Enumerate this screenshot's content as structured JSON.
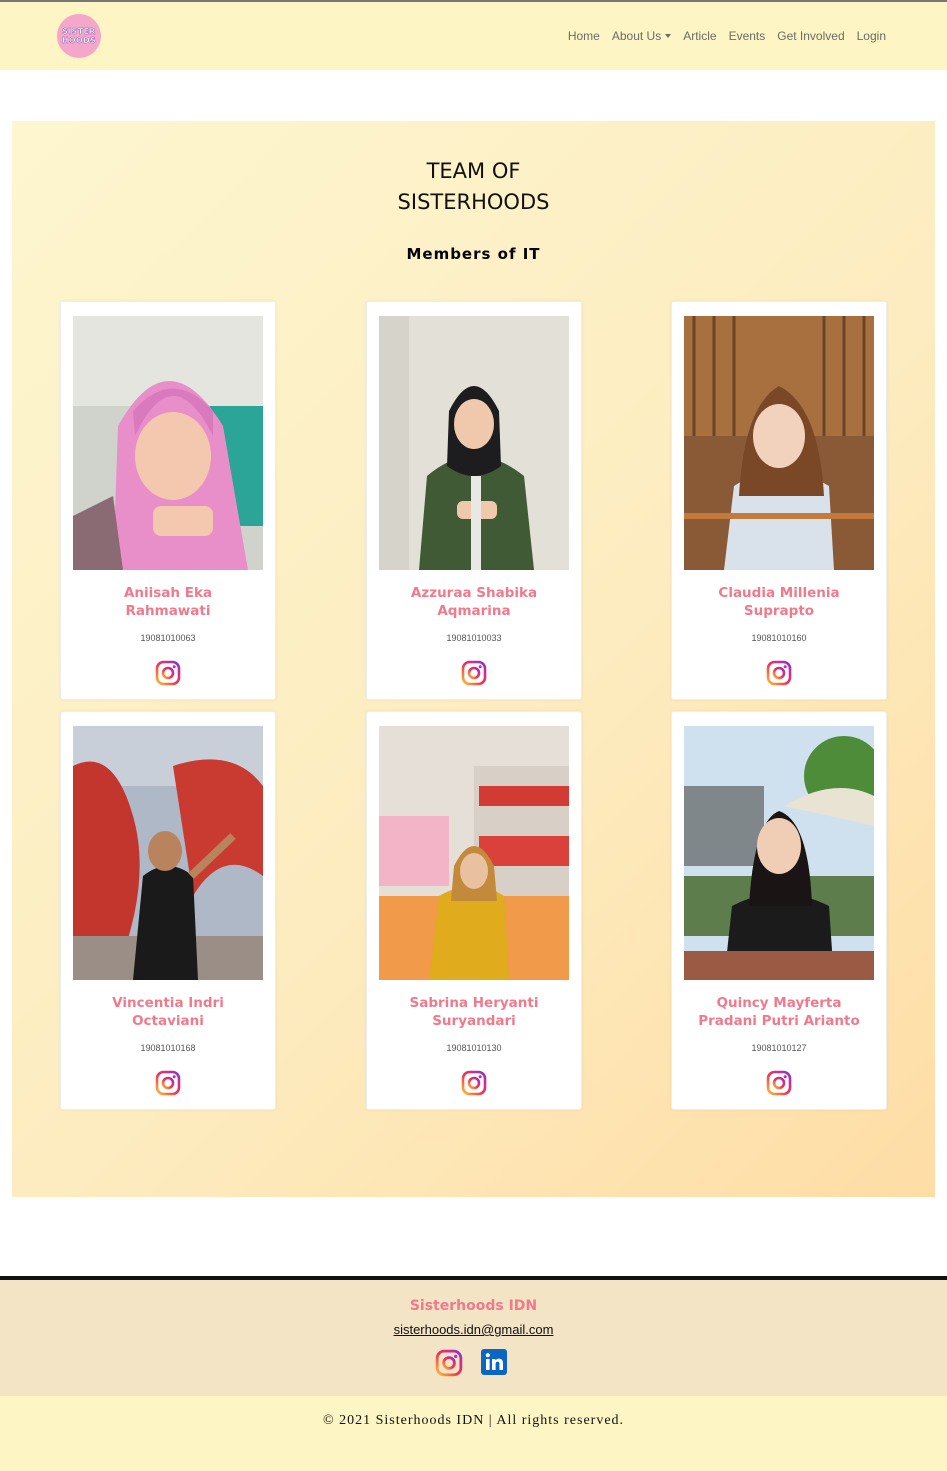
{
  "nav": {
    "logo_text": "SISTER HOODS",
    "items": [
      {
        "label": "Home"
      },
      {
        "label": "About Us"
      },
      {
        "label": "Article"
      },
      {
        "label": "Events"
      },
      {
        "label": "Get Involved"
      },
      {
        "label": "Login"
      }
    ]
  },
  "hero": {
    "title_line1": "TEAM OF",
    "title_line2": "SISTERHOODS",
    "subtitle": "Members of IT"
  },
  "members": [
    {
      "name_line1": "Aniisah Eka",
      "name_line2": "Rahmawati",
      "id": "19081010063",
      "icon": "instagram-icon"
    },
    {
      "name_line1": "Azzuraa Shabika",
      "name_line2": "Aqmarina",
      "id": "19081010033",
      "icon": "instagram-icon"
    },
    {
      "name_line1": "Claudia Millenia",
      "name_line2": "Suprapto",
      "id": "19081010160",
      "icon": "instagram-icon"
    },
    {
      "name_line1": "Vincentia Indri",
      "name_line2": "Octaviani",
      "id": "19081010168",
      "icon": "instagram-icon"
    },
    {
      "name_line1": "Sabrina Heryanti",
      "name_line2": "Suryandari",
      "id": "19081010130",
      "icon": "instagram-icon"
    },
    {
      "name_line1": "Quincy Mayferta",
      "name_line2": "Pradani Putri Arianto",
      "id": "19081010127",
      "icon": "instagram-icon"
    }
  ],
  "footer": {
    "brand": "Sisterhoods IDN",
    "email": "sisterhoods.idn@gmail.com",
    "icons": [
      "instagram-icon",
      "linkedin-icon"
    ],
    "copyright": "© 2021 Sisterhoods IDN | All rights reserved."
  },
  "colors": {
    "nav_bg": "#fdf5c4",
    "accent_pink": "#f07a8c",
    "footer_bg": "#f3e4c6"
  }
}
